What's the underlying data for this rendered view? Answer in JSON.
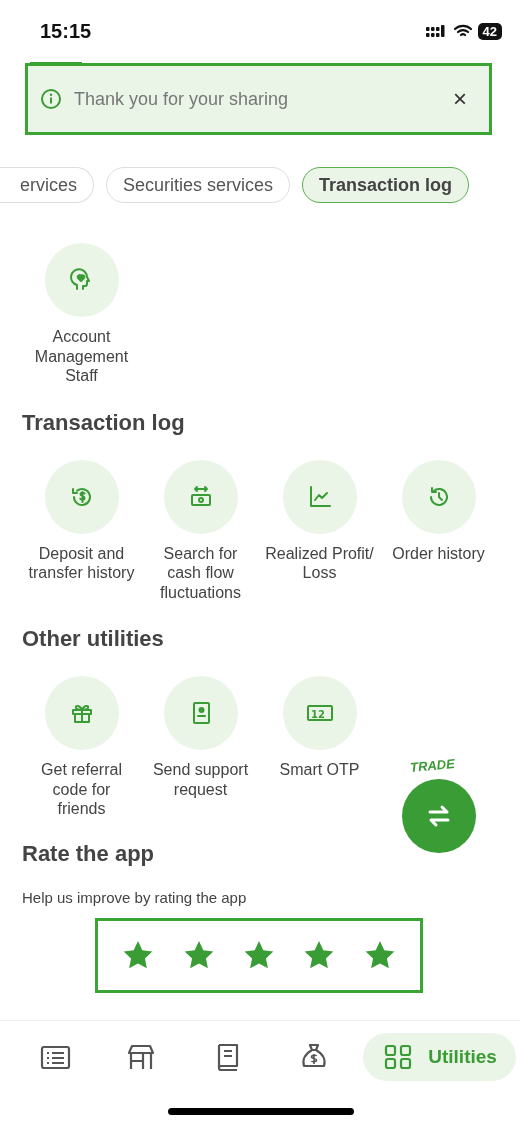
{
  "status_bar": {
    "time": "15:15",
    "battery": "42"
  },
  "toast": {
    "message": "Thank you for your sharing",
    "close": "×"
  },
  "tabs": [
    {
      "label": "ervices",
      "selected": false
    },
    {
      "label": "Securities services",
      "selected": false
    },
    {
      "label": "Transaction log",
      "selected": true
    }
  ],
  "sections": [
    {
      "items": [
        {
          "label": "Account Management Staff"
        }
      ]
    },
    {
      "title": "Transaction log",
      "items": [
        {
          "label": "Deposit and transfer history"
        },
        {
          "label": "Search for cash flow fluctuations"
        },
        {
          "label": "Realized Profit/ Loss"
        },
        {
          "label": "Order history"
        }
      ]
    },
    {
      "title": "Other utilities",
      "items": [
        {
          "label": "Get referral code for friends"
        },
        {
          "label": "Send support request"
        },
        {
          "label": "Smart OTP",
          "badge": "12"
        }
      ]
    }
  ],
  "trade_button": {
    "label": "TRADE"
  },
  "rating": {
    "title": "Rate the app",
    "prompt": "Help us improve by rating the app",
    "stars": 5
  },
  "bottom_nav": [
    {
      "selected": false
    },
    {
      "selected": false
    },
    {
      "selected": false
    },
    {
      "selected": false
    },
    {
      "label": "Utilities",
      "selected": true
    }
  ]
}
